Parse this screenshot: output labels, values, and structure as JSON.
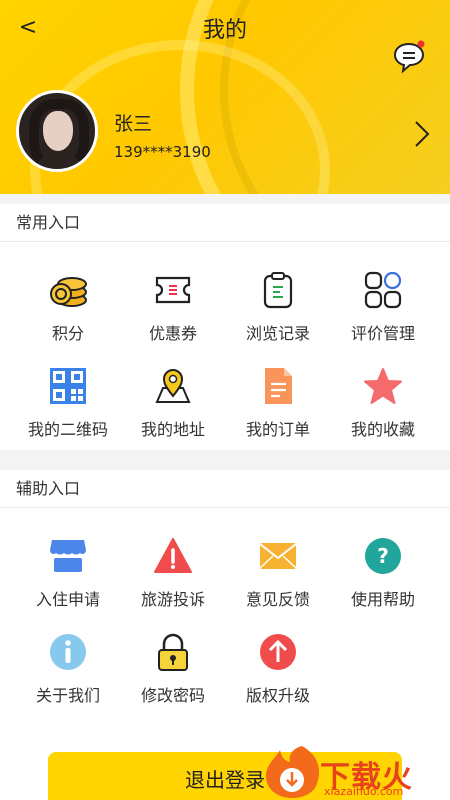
{
  "header": {
    "back_icon": "<",
    "title": "我的",
    "message_icon": "chat-bubble-icon"
  },
  "user": {
    "name": "张三",
    "phone": "139****3190"
  },
  "common": {
    "title": "常用入口",
    "items": [
      {
        "label": "积分",
        "icon": "coins-icon"
      },
      {
        "label": "优惠券",
        "icon": "ticket-icon"
      },
      {
        "label": "浏览记录",
        "icon": "clipboard-icon"
      },
      {
        "label": "评价管理",
        "icon": "grid-icon"
      },
      {
        "label": "我的二维码",
        "icon": "qrcode-icon"
      },
      {
        "label": "我的地址",
        "icon": "map-pin-icon"
      },
      {
        "label": "我的订单",
        "icon": "document-icon"
      },
      {
        "label": "我的收藏",
        "icon": "star-icon"
      }
    ]
  },
  "assist": {
    "title": "辅助入口",
    "items": [
      {
        "label": "入住申请",
        "icon": "shop-icon"
      },
      {
        "label": "旅游投诉",
        "icon": "warning-icon"
      },
      {
        "label": "意见反馈",
        "icon": "envelope-icon"
      },
      {
        "label": "使用帮助",
        "icon": "help-icon"
      },
      {
        "label": "关于我们",
        "icon": "info-icon"
      },
      {
        "label": "修改密码",
        "icon": "lock-icon"
      },
      {
        "label": "版权升级",
        "icon": "upgrade-icon"
      }
    ]
  },
  "logout_label": "退出登录",
  "watermark": {
    "text": "下载火",
    "url": "xiazaihuo.com"
  },
  "colors": {
    "brand_yellow": "#ffd400",
    "accent_red": "#e8421c"
  }
}
